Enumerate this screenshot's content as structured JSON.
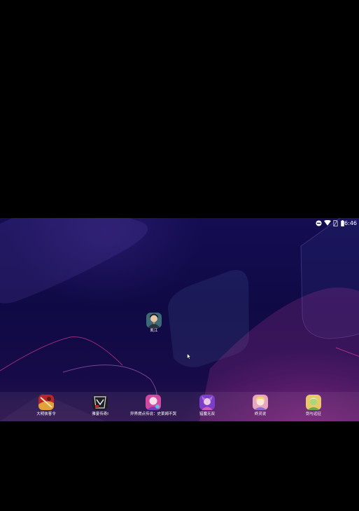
{
  "status_bar": {
    "time": "6:46",
    "icons": [
      "do-not-disturb-icon",
      "wifi-icon",
      "no-sim-icon",
      "battery-icon"
    ]
  },
  "desktop": {
    "apps": [
      {
        "label": "凯江",
        "icon": "game-character-icon"
      }
    ]
  },
  "dock": {
    "apps": [
      {
        "label": "大明侠客令",
        "icon": "daming-xiakeling-icon"
      },
      {
        "label": "雅宴传奇I",
        "icon": "yayan-chuanqi-icon"
      },
      {
        "label": "异界燃点传说：史莱姆不哭",
        "icon": "slime-legend-icon"
      },
      {
        "label": "猎魔无双",
        "icon": "liemo-wushuang-icon"
      },
      {
        "label": "终灵说",
        "icon": "zhongling-shuo-icon"
      },
      {
        "label": "剑与远征",
        "icon": "afk-arena-icon"
      }
    ]
  },
  "colors": {
    "background": "#000000",
    "wallpaper_top": "#140d52",
    "wallpaper_accent": "#962c8c"
  }
}
